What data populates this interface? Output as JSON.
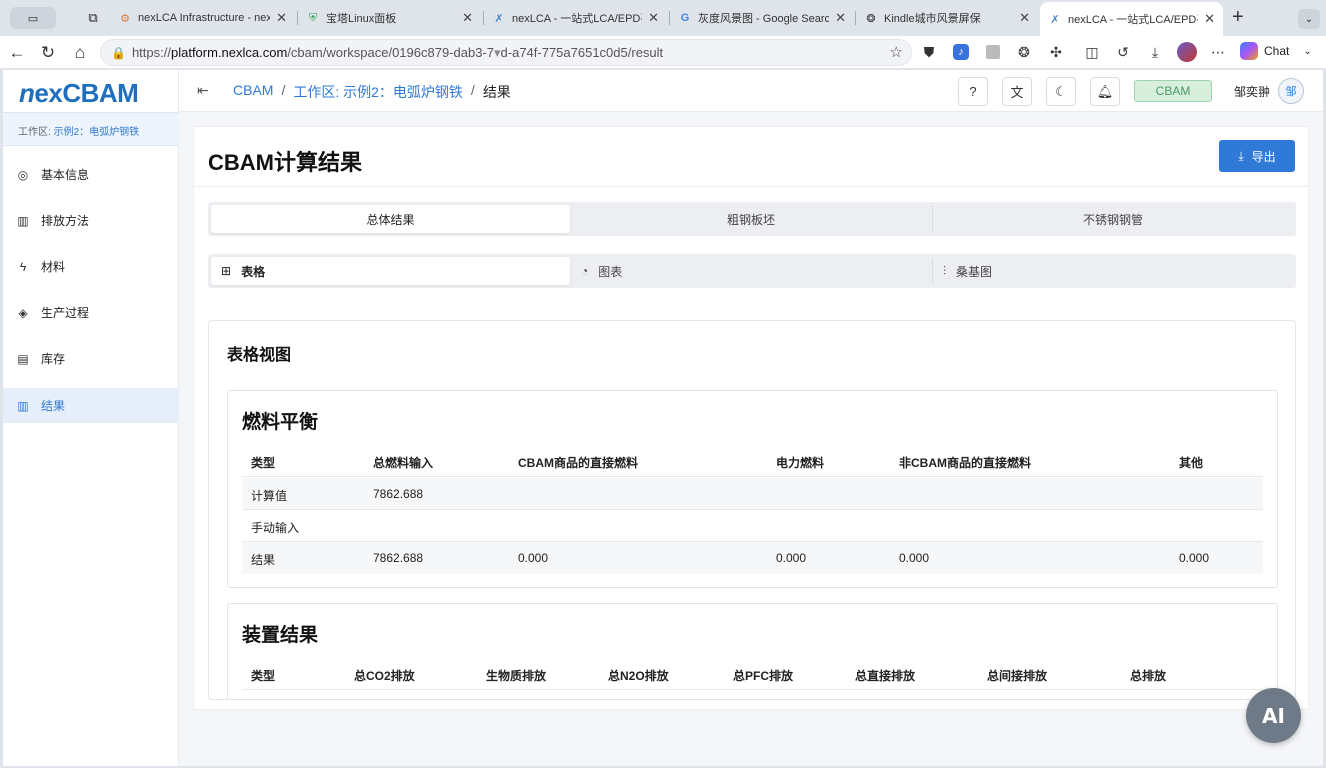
{
  "browser": {
    "tabs": [
      {
        "title": "nexLCA Infrastructure - nex",
        "icon": "gear-orange-icon"
      },
      {
        "title": "宝塔Linux面板",
        "icon": "shield-icon"
      },
      {
        "title": "nexLCA - 一站式LCA/EPD平",
        "icon": "x-logo-icon"
      },
      {
        "title": "灰度风景图 - Google Search",
        "icon": "google-icon"
      },
      {
        "title": "Kindle城市风景屏保",
        "icon": "openai-icon"
      },
      {
        "title": "nexLCA - 一站式LCA/EPD平",
        "icon": "x-logo-icon",
        "active": true
      }
    ],
    "url_prefix": "https://",
    "url_host": "platform.nexlca.com",
    "url_path": "/cbam/workspace/0196c879-dab3-7",
    "url_suffix": "d-a74f-775a7651c0d5/result",
    "chat_label": "Chat"
  },
  "app": {
    "logo_n": "n",
    "logo_ex": "ex",
    "logo_cbam": "CBAM",
    "workspace_prefix": "工作区: ",
    "workspace_name": "示例2：电弧炉钢铁",
    "sidebar": [
      {
        "label": "基本信息",
        "icon": "target-icon"
      },
      {
        "label": "排放方法",
        "icon": "bar-chart-icon"
      },
      {
        "label": "材料",
        "icon": "lightning-icon"
      },
      {
        "label": "生产过程",
        "icon": "layers-icon"
      },
      {
        "label": "库存",
        "icon": "building-icon"
      },
      {
        "label": "结果",
        "icon": "bar-chart-icon",
        "active": true
      }
    ],
    "breadcrumb": {
      "root": "CBAM",
      "sep": "/",
      "workspace": "工作区: 示例2：电弧炉钢铁",
      "current": "结果"
    },
    "header": {
      "help": "?",
      "cbam_badge": "CBAM",
      "username": "邹奕翀",
      "avatar_text": "邹"
    },
    "page_title": "CBAM计算结果",
    "export_label": "导出",
    "product_tabs": [
      "总体结果",
      "粗钢板坯",
      "不锈钢钢管"
    ],
    "view_tabs": [
      "表格",
      "图表",
      "桑基图"
    ],
    "panel_title": "表格视图",
    "fuel_balance": {
      "title": "燃料平衡",
      "headers": [
        "类型",
        "总燃料输入",
        "CBAM商品的直接燃料",
        "电力燃料",
        "非CBAM商品的直接燃料",
        "其他"
      ],
      "rows": [
        [
          "计算值",
          "7862.688",
          "",
          "",
          "",
          ""
        ],
        [
          "手动输入",
          "",
          "",
          "",
          "",
          ""
        ],
        [
          "结果",
          "7862.688",
          "0.000",
          "0.000",
          "0.000",
          "0.000"
        ]
      ]
    },
    "installation_results": {
      "title": "装置结果",
      "headers": [
        "类型",
        "总CO2排放",
        "生物质排放",
        "总N2O排放",
        "总PFC排放",
        "总直接排放",
        "总间接排放",
        "总排放"
      ]
    },
    "ai_button": "AI"
  }
}
